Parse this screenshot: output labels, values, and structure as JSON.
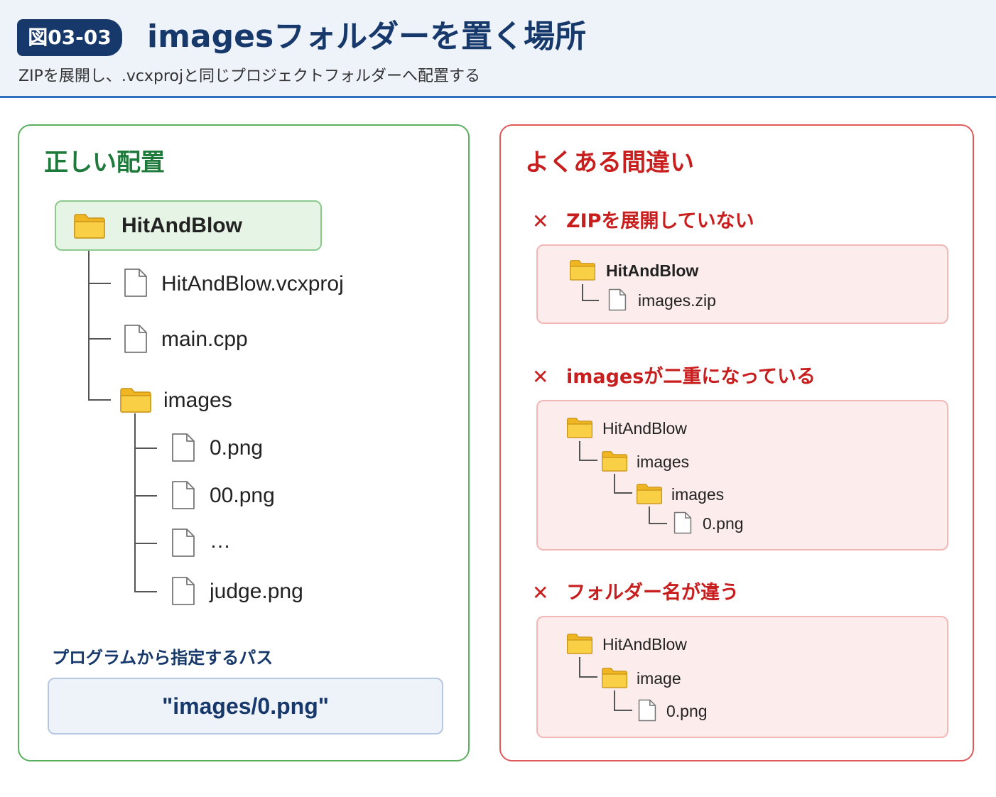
{
  "header": {
    "badge": "図03-03",
    "title": "imagesフォルダーを置く場所",
    "subtitle": "ZIPを展開し、.vcxprojと同じプロジェクトフォルダーへ配置する"
  },
  "correct": {
    "title": "正しい配置",
    "root": "HitAndBlow",
    "items": [
      "HitAndBlow.vcxproj",
      "main.cpp"
    ],
    "images_folder": "images",
    "image_files": [
      "0.png",
      "00.png",
      "…",
      "judge.png"
    ],
    "path_label": "プログラムから指定するパス",
    "path_value": "\"images/0.png\""
  },
  "mistakes": {
    "title": "よくある間違い",
    "mark": "✕",
    "cases": [
      {
        "title": "ZIPを展開していない",
        "root": "HitAndBlow",
        "file": "images.zip"
      },
      {
        "title": "imagesが二重になっている",
        "root": "HitAndBlow",
        "folder1": "images",
        "folder2": "images",
        "file": "0.png"
      },
      {
        "title": "フォルダー名が違う",
        "root": "HitAndBlow",
        "folder1": "image",
        "file": "0.png"
      }
    ]
  },
  "colors": {
    "navy": "#17386a",
    "correct_green": "#1e7a3a",
    "mistake_red": "#c81e1e",
    "folder_yellow": "#f7c93a"
  }
}
